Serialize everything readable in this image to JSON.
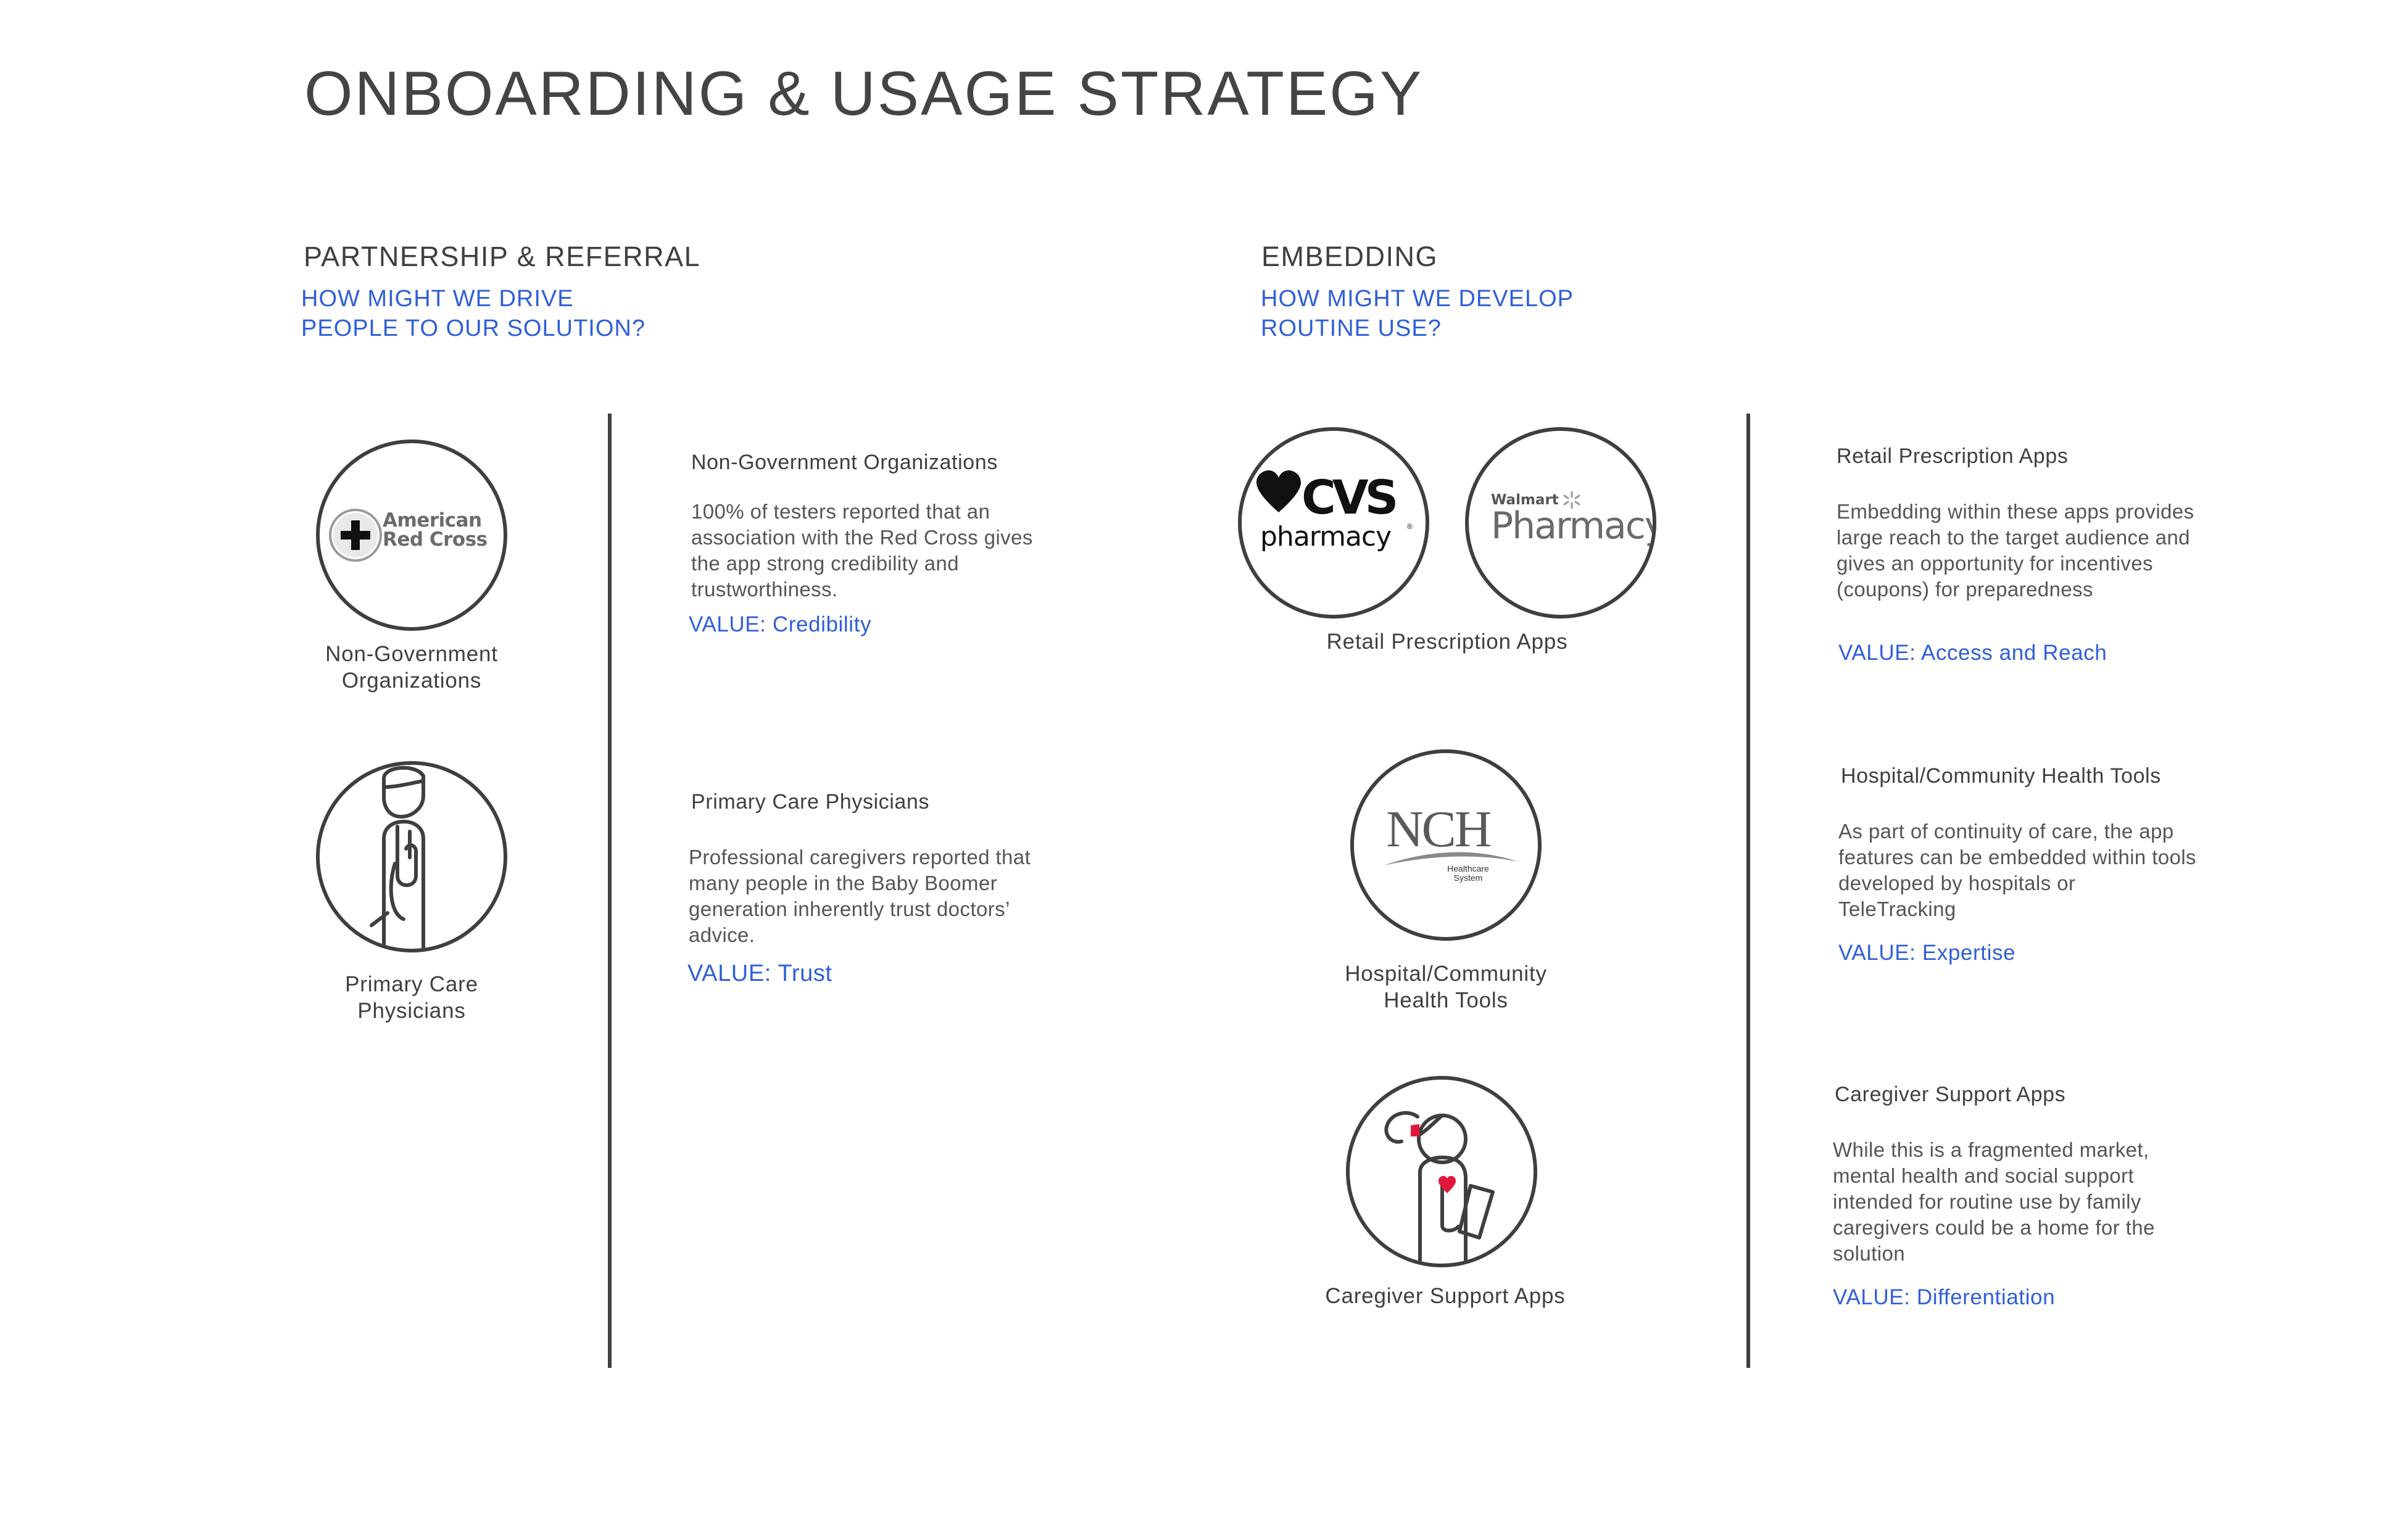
{
  "page_title": "ONBOARDING & USAGE STRATEGY",
  "colors": {
    "text": "#3f3f3f",
    "accent_blue": "#2f5fd8",
    "heart_red": "#e0173a"
  },
  "partnership": {
    "title": "PARTNERSHIP & REFERRAL",
    "question": "HOW MIGHT WE DRIVE PEOPLE TO OUR SOLUTION?",
    "icons": [
      {
        "icon": "american-red-cross-logo",
        "logo_line1": "American",
        "logo_line2": "Red Cross",
        "label": "Non-Government Organizations"
      },
      {
        "icon": "physician-icon",
        "label": "Primary Care Physicians"
      }
    ],
    "items": [
      {
        "heading": "Non-Government Organizations",
        "body": "100% of testers reported that an association with the Red Cross gives the app strong credibility and trustworthiness.",
        "value": "VALUE: Credibility"
      },
      {
        "heading": "Primary Care Physicians",
        "body": "Professional caregivers reported that many people in the Baby Boomer generation inherently trust doctors’ advice.",
        "value": "VALUE: Trust"
      }
    ]
  },
  "embedding": {
    "title": "EMBEDDING",
    "question": "HOW MIGHT WE DEVELOP ROUTINE USE?",
    "icons": [
      {
        "label": "Retail Prescription Apps",
        "cvs_logo": {
          "word": "CVS",
          "sub": "pharmacy",
          "mark": "®"
        },
        "walmart_logo": {
          "top": "Walmart",
          "word": "Pharmacy"
        }
      },
      {
        "label": "Hospital/Community Health Tools",
        "nch_logo": {
          "word": "NCH",
          "sub1": "Healthcare",
          "sub2": "System"
        }
      },
      {
        "icon": "caregiver-icon",
        "label": "Caregiver Support Apps"
      }
    ],
    "items": [
      {
        "heading": "Retail Prescription Apps",
        "body": "Embedding within these apps provides large reach to the target audience and gives an opportunity for incentives (coupons) for preparedness",
        "value": "VALUE: Access and Reach"
      },
      {
        "heading": "Hospital/Community Health Tools",
        "body": "As part of continuity of care, the app features can be embedded within tools developed by hospitals or TeleTracking",
        "value": "VALUE: Expertise"
      },
      {
        "heading": "Caregiver Support Apps",
        "body": "While this is a fragmented market, mental health and social support intended for routine use by family caregivers could be a home for the solution",
        "value": "VALUE: Differentiation"
      }
    ]
  }
}
